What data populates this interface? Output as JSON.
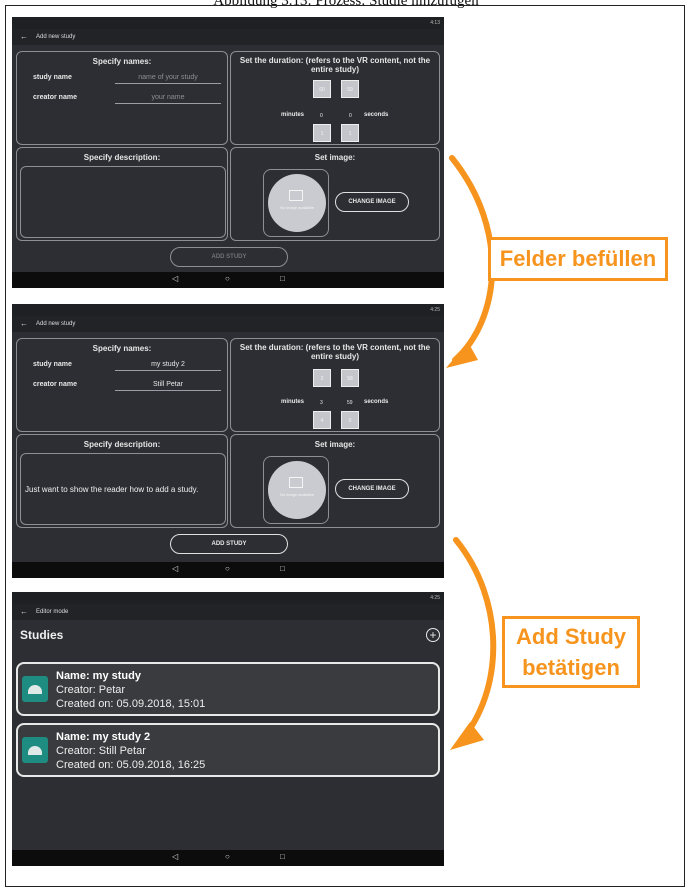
{
  "caption": "Abbildung 3.13: Prozess: Studie hinzufügen",
  "screen1": {
    "status_time": "4:13",
    "appbar_title": "Add new study",
    "names_title": "Specify names:",
    "study_name_label": "study name",
    "study_name_placeholder": "name of your study",
    "creator_name_label": "creator name",
    "creator_name_placeholder": "your name",
    "duration_title": "Set the duration: (refers to the VR content, not the entire study)",
    "min_above": "60",
    "sec_above": "59",
    "minutes_label": "minutes",
    "minutes_value": "0",
    "seconds_value": "0",
    "seconds_label": "seconds",
    "min_below": "1",
    "sec_below": "1",
    "description_title": "Specify description:",
    "description_value": "",
    "image_title": "Set image:",
    "no_image": "No image available",
    "change_image": "CHANGE IMAGE",
    "add_study": "ADD STUDY"
  },
  "screen2": {
    "status_time": "4:25",
    "appbar_title": "Add new study",
    "names_title": "Specify names:",
    "study_name_label": "study name",
    "study_name_value": "my study 2",
    "creator_name_label": "creator name",
    "creator_name_value": "Still Petar",
    "duration_title": "Set the duration: (refers to the VR content, not the entire study)",
    "min_above": "2",
    "sec_above": "58",
    "minutes_label": "minutes",
    "minutes_value": "3",
    "seconds_value": "59",
    "seconds_label": "seconds",
    "min_below": "4",
    "sec_below": "0",
    "description_title": "Specify description:",
    "description_value": "Just want to show the reader how to add a study.",
    "image_title": "Set image:",
    "no_image": "No image available",
    "change_image": "CHANGE IMAGE",
    "add_study": "ADD STUDY"
  },
  "screen3": {
    "status_time": "4:25",
    "appbar_title": "Editor mode",
    "studies_title": "Studies",
    "studies": [
      {
        "name": "Name: my study",
        "creator": "Creator: Petar",
        "created": "Created on: 05.09.2018, 15:01"
      },
      {
        "name": "Name: my study 2",
        "creator": "Creator: Still Petar",
        "created": "Created on: 05.09.2018, 16:25"
      }
    ]
  },
  "nav_icons": [
    "back-triangle-icon",
    "home-circle-icon",
    "recents-square-icon"
  ],
  "annotations": {
    "fill_fields": "Felder befüllen",
    "press_add": "Add Study betätigen"
  },
  "colors": {
    "accent_orange": "#f7941d",
    "app_bg": "#2c2e33",
    "app_icon": "#1e8c80"
  }
}
